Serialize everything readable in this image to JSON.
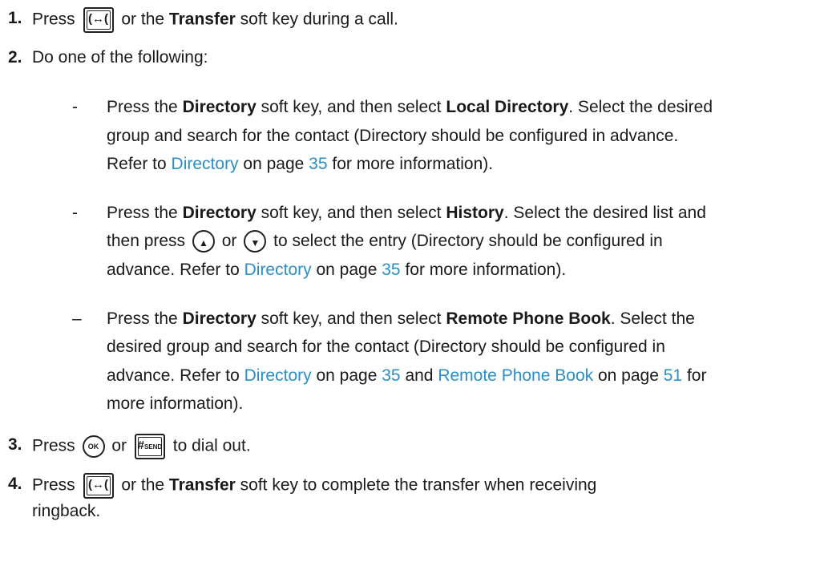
{
  "steps": {
    "s1": {
      "num": "1.",
      "pre": "Press",
      "mid": "or the",
      "bold": "Transfer",
      "post": "soft key during a call."
    },
    "s2": {
      "num": "2.",
      "text": "Do one of the following:"
    },
    "o1": {
      "dash": "-",
      "l1a": "Press the",
      "l1b": "Directory",
      "l1c": "soft key, and then select",
      "l1d": "Local Directory",
      "l1e": ". Select the desired",
      "l2": "group and search for the contact (Directory should be configured in advance.",
      "l3a": "Refer to",
      "l3link": "Directory",
      "l3b": "on page",
      "l3page": "35",
      "l3c": "for more information)."
    },
    "o2": {
      "dash": "-",
      "l1a": "Press the",
      "l1b": "Directory",
      "l1c": "soft key, and then select",
      "l1d": "History",
      "l1e": ". Select the desired list and",
      "l2a": "then press",
      "l2b": "or",
      "l2c": "to select the entry (Directory should be configured in",
      "l3a": "advance. Refer to",
      "l3link": "Directory",
      "l3b": "on page",
      "l3page": "35",
      "l3c": "for more information)."
    },
    "o3": {
      "dash": "–",
      "l1a": "Press the",
      "l1b": "Directory",
      "l1c": "soft key, and then select",
      "l1d": "Remote Phone Book",
      "l1e": ". Select the",
      "l2": "desired group and search for the contact (Directory should be configured in",
      "l3a": "advance. Refer to",
      "l3link1": "Directory",
      "l3b": "on page",
      "l3page1": "35",
      "l3c": "and",
      "l3link2": "Remote Phone Book",
      "l3d": "on page",
      "l3page2": "51",
      "l3e": "for",
      "l4": "more information)."
    },
    "s3": {
      "num": "3.",
      "pre": "Press",
      "ok": "OK",
      "mid": "or",
      "hash": "#",
      "send": "SEND",
      "post": "to dial out."
    },
    "s4": {
      "num": "4.",
      "pre": "Press",
      "mid": "or the",
      "bold": "Transfer",
      "post": "soft key to complete the transfer when receiving",
      "l2": "ringback."
    }
  },
  "icons": {
    "transfer": "transfer-key-icon",
    "up": "up-arrow-key-icon",
    "down": "down-arrow-key-icon",
    "ok": "ok-key-icon",
    "send": "hash-send-key-icon"
  },
  "colors": {
    "link": "#2a8fc8",
    "text": "#1a1a1a"
  }
}
